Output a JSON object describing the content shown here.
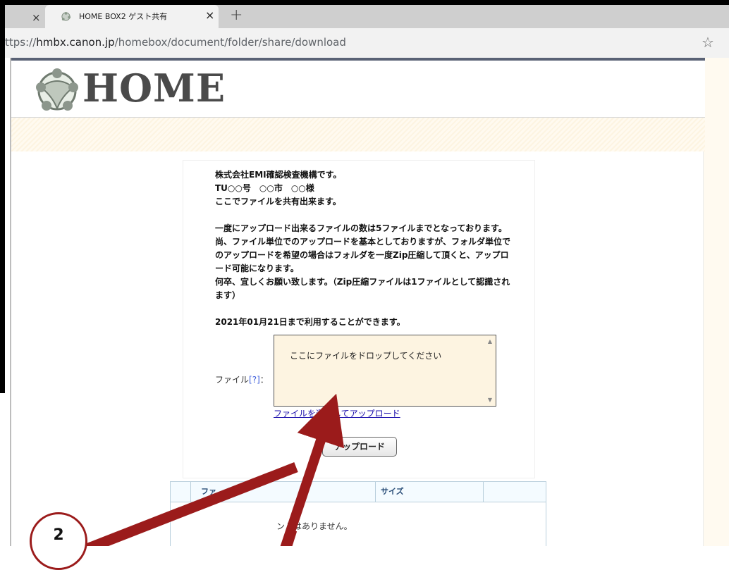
{
  "browser": {
    "prev_tab_close": "×",
    "tab": {
      "title": "HOME BOX2 ゲスト共有",
      "close": "×"
    },
    "new_tab": "+",
    "url_prefix": "ttps://",
    "url_host": "hmbx.canon.jp",
    "url_path": "/homebox/document/folder/share/download",
    "bookmark_star": "☆"
  },
  "logo": {
    "text": "HOME",
    "icon": "home-box-logo-icon"
  },
  "message": {
    "lines": [
      "株式会社EMI確認検査機構です。",
      "TU○○号　○○市　○○様",
      "ここでファイルを共有出来ます。",
      "",
      "一度にアップロード出来るファイルの数は5ファイルまでとなっております。",
      "尚、ファイル単位でのアップロードを基本としておりますが、フォルダ単位でのアップロードを希望の場合はフォルダを一度Zip圧縮して頂くと、アップロード可能になります。",
      "何卒、宜しくお願い致します。（Zip圧縮ファイルは1ファイルとして認識されます）"
    ],
    "availability": "2021年01月21日まで利用することができます。"
  },
  "upload": {
    "file_label": "ファイル",
    "help_link": "[?]",
    "label_colon": "：",
    "dropzone_text": "ここにファイルをドロップしてください",
    "select_link": "ファイルを選択してアップロード",
    "upload_button": "アップロード"
  },
  "file_table": {
    "columns": [
      "ファ",
      "サイズ"
    ],
    "empty_message": "ントはありません。"
  },
  "annotation": {
    "step_number": "2",
    "color": "#9b1b1b"
  }
}
